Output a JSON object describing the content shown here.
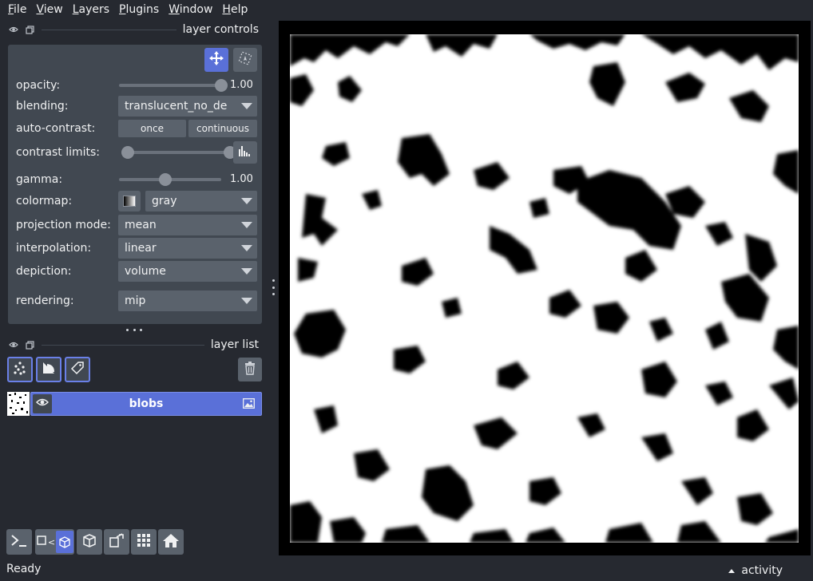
{
  "menubar": {
    "items": [
      {
        "label": "File",
        "underline": "F",
        "rest": "ile"
      },
      {
        "label": "View",
        "underline": "V",
        "rest": "iew"
      },
      {
        "label": "Layers",
        "underline": "L",
        "rest": "ayers"
      },
      {
        "label": "Plugins",
        "underline": "P",
        "rest": "lugins"
      },
      {
        "label": "Window",
        "underline": "W",
        "rest": "indow"
      },
      {
        "label": "Help",
        "underline": "H",
        "rest": "elp"
      }
    ]
  },
  "layer_controls": {
    "title": "layer controls",
    "opacity": {
      "label": "opacity:",
      "value": "1.00",
      "level": 1.0
    },
    "blending": {
      "label": "blending:",
      "value": "translucent_no_de"
    },
    "auto_contrast": {
      "label": "auto-contrast:",
      "once": "once",
      "continuous": "continuous"
    },
    "contrast_limits": {
      "label": "contrast limits:",
      "low": 0.0,
      "high": 1.0
    },
    "gamma": {
      "label": "gamma:",
      "value": "1.00",
      "level": 0.45
    },
    "colormap": {
      "label": "colormap:",
      "value": "gray"
    },
    "projection_mode": {
      "label": "projection mode:",
      "value": "mean"
    },
    "interpolation": {
      "label": "interpolation:",
      "value": "linear"
    },
    "depiction": {
      "label": "depiction:",
      "value": "volume"
    },
    "rendering": {
      "label": "rendering:",
      "value": "mip"
    }
  },
  "layer_list": {
    "title": "layer list",
    "layers": [
      {
        "name": "blobs",
        "type": "image",
        "visible": true,
        "selected": true
      }
    ]
  },
  "status": {
    "text": "Ready",
    "activity": "activity"
  },
  "colors": {
    "accent": "#5a70d8",
    "panel": "#414851",
    "background": "#262930"
  }
}
